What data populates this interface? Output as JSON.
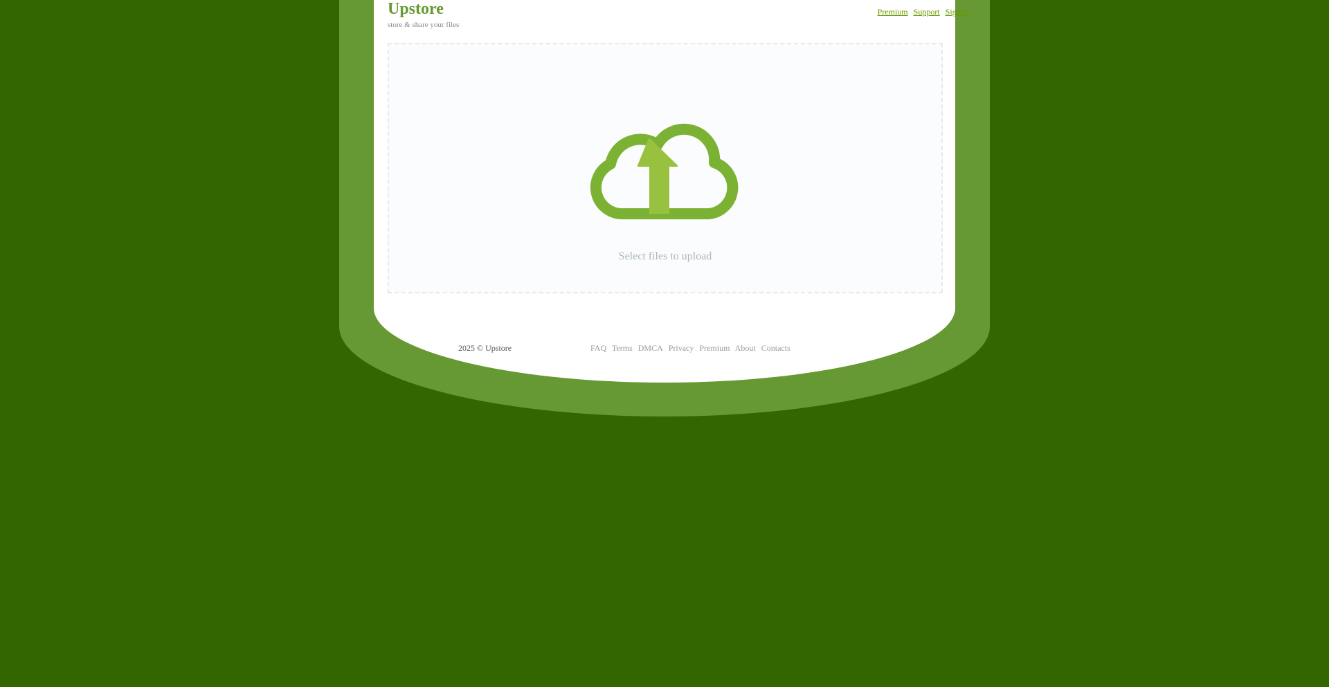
{
  "header": {
    "logo": "Upstore",
    "tagline": "store & share your files",
    "nav": [
      "Premium",
      "Support",
      "Sign in"
    ]
  },
  "upload": {
    "prompt": "Select files to upload",
    "icon": "cloud-upload-icon"
  },
  "footer": {
    "copyright": "2025 © Upstore",
    "links": [
      "FAQ",
      "Terms",
      "DMCA",
      "Privacy",
      "Premium",
      "About",
      "Contacts"
    ]
  },
  "colors": {
    "background": "#336600",
    "frame": "#669933",
    "brand": "#669933",
    "link": "#669900",
    "cloud": "#7cb233",
    "arrow": "#99c140"
  }
}
